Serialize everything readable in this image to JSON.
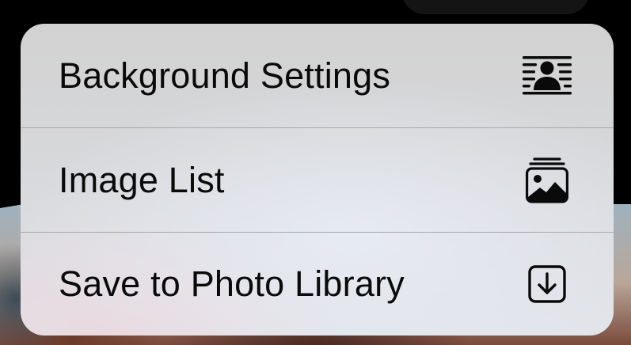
{
  "menu": {
    "items": [
      {
        "label": "Background Settings",
        "icon": "background-settings-icon"
      },
      {
        "label": "Image List",
        "icon": "image-stack-icon"
      },
      {
        "label": "Save to Photo Library",
        "icon": "save-download-icon"
      }
    ]
  },
  "colors": {
    "menu_background": "#d6d7d9",
    "separator": "#a9a9ab",
    "text": "#0a0a0a",
    "backdrop": "#000000"
  }
}
